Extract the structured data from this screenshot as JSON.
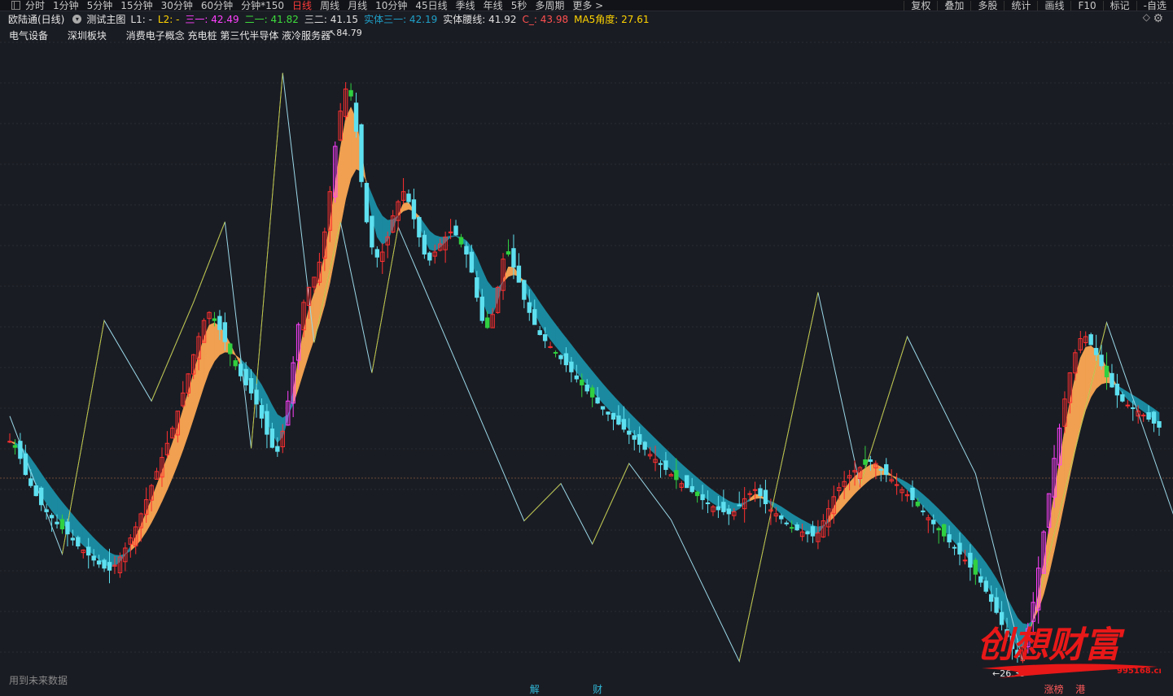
{
  "toolbar": {
    "periods": [
      "分时",
      "1分钟",
      "5分钟",
      "15分钟",
      "30分钟",
      "60分钟",
      "分钟*150",
      "日线",
      "周线",
      "月线",
      "10分钟",
      "45日线",
      "季线",
      "年线",
      "5秒",
      "多周期",
      "更多 >"
    ],
    "active_period": "日线",
    "tools": [
      "复权",
      "叠加",
      "多股",
      "统计",
      "画线",
      "F10",
      "标记",
      "-自选"
    ]
  },
  "info": {
    "stock_name": "欧陆通(日线)",
    "indicator_name": "测试主图",
    "items": [
      {
        "label": "L1: -",
        "color": "#e0e0e0"
      },
      {
        "label": "L2: -",
        "color": "#ffd400"
      },
      {
        "label": "三一: 42.49",
        "color": "#ff40ff"
      },
      {
        "label": "二一: 41.82",
        "color": "#3cdc3c"
      },
      {
        "label": "三二: 41.15",
        "color": "#e0e0e0"
      },
      {
        "label": "实体三一: 42.19",
        "color": "#1fa0c8"
      },
      {
        "label": "实体腰线: 41.92",
        "color": "#e0e0e0"
      },
      {
        "label": "C_: 43.98",
        "color": "#ff5050"
      },
      {
        "label": "MA5角度: 27.61",
        "color": "#ffd400"
      }
    ]
  },
  "sectors": [
    "电气设备",
    "深圳板块",
    "消费电子概念 充电桩 第三代半导体 液冷服务器"
  ],
  "chart_data": {
    "type": "candlestick",
    "title": "欧陆通(日线)",
    "high_label": "84.79",
    "low_label": "26.35",
    "closes": [
      48.2,
      47.6,
      46.5,
      44.9,
      43.8,
      42.8,
      41.9,
      41.2,
      40.6,
      40.0,
      39.5,
      39.0,
      38.4,
      37.8,
      37.4,
      36.9,
      36.4,
      36.0,
      35.6,
      35.4,
      35.9,
      36.7,
      37.6,
      38.6,
      39.7,
      41.0,
      42.4,
      43.8,
      45.2,
      46.6,
      48.0,
      49.5,
      51.2,
      53.0,
      54.9,
      56.8,
      58.6,
      60.2,
      61.0,
      60.2,
      59.3,
      58.1,
      56.9,
      55.7,
      54.7,
      53.8,
      53.0,
      51.9,
      50.5,
      48.9,
      47.6,
      47.2,
      49.2,
      52.2,
      56.0,
      59.8,
      62.0,
      63.5,
      64.5,
      66.0,
      69.0,
      73.0,
      77.5,
      81.0,
      83.2,
      82.5,
      79.0,
      74.0,
      70.0,
      67.5,
      66.5,
      67.0,
      68.5,
      70.6,
      72.0,
      73.0,
      72.0,
      70.3,
      68.5,
      66.8,
      66.2,
      67.0,
      67.8,
      68.5,
      69.0,
      68.7,
      67.8,
      66.8,
      65.0,
      62.5,
      60.2,
      59.5,
      60.8,
      63.5,
      66.3,
      66.8,
      65.5,
      64.0,
      62.3,
      61.0,
      59.8,
      58.8,
      58.2,
      57.6,
      57.0,
      56.4,
      55.8,
      55.1,
      54.4,
      53.8,
      53.2,
      52.6,
      52.0,
      51.4,
      50.9,
      50.4,
      49.9,
      49.4,
      48.9,
      48.4,
      47.9,
      47.4,
      46.9,
      46.4,
      45.9,
      45.4,
      44.9,
      44.4,
      44.0,
      43.6,
      43.2,
      42.8,
      42.4,
      42.0,
      41.7,
      41.4,
      41.2,
      41.0,
      41.2,
      41.8,
      42.5,
      43.0,
      43.4,
      42.8,
      42.0,
      41.4,
      41.0,
      40.5,
      40.0,
      39.6,
      39.4,
      39.2,
      39.0,
      38.8,
      39.1,
      40.3,
      41.5,
      42.7,
      43.6,
      44.2,
      44.8,
      45.3,
      45.6,
      45.9,
      46.2,
      46.0,
      45.4,
      44.9,
      44.4,
      43.9,
      43.4,
      42.9,
      42.4,
      41.8,
      41.2,
      40.6,
      40.0,
      39.4,
      38.8,
      38.2,
      37.6,
      37.0,
      36.4,
      35.7,
      35.0,
      34.2,
      33.3,
      32.3,
      31.2,
      30.0,
      28.8,
      27.6,
      26.8,
      27.8,
      29.6,
      32.2,
      35.6,
      39.2,
      43.0,
      46.5,
      49.5,
      52.4,
      55.0,
      57.0,
      58.4,
      58.6,
      57.8,
      56.8,
      55.7,
      54.6,
      53.6,
      52.8,
      52.2,
      51.8,
      51.5,
      51.2,
      50.8,
      50.4,
      50.0,
      49.6
    ],
    "zigzag": [
      [
        0,
        50.7
      ],
      [
        10,
        37.0
      ],
      [
        18,
        60.2
      ],
      [
        27,
        52.2
      ],
      [
        35,
        62.0
      ],
      [
        41,
        70.0
      ],
      [
        46,
        47.5
      ],
      [
        52,
        84.79
      ],
      [
        58,
        58.0
      ],
      [
        63,
        70.0
      ],
      [
        69,
        55.0
      ],
      [
        74,
        69.5
      ],
      [
        98,
        40.3
      ],
      [
        105,
        44.0
      ],
      [
        111,
        38.0
      ],
      [
        118,
        46.0
      ],
      [
        126,
        40.4
      ],
      [
        139,
        26.35
      ],
      [
        154,
        63.0
      ],
      [
        162,
        43.8
      ],
      [
        171,
        58.6
      ],
      [
        184,
        45.0
      ],
      [
        193,
        26.35
      ],
      [
        209,
        60.0
      ],
      [
        223,
        39.0
      ],
      [
        228,
        43.98
      ]
    ],
    "bottom_markers": [
      {
        "i": 100,
        "text": "解",
        "color": "#30b8d8"
      },
      {
        "i": 112,
        "text": "财",
        "color": "#30b8d8"
      },
      {
        "i": 198,
        "text": "涨榜",
        "color": "#ff5a5a"
      },
      {
        "i": 204,
        "text": "港",
        "color": "#ff5a5a"
      }
    ],
    "ylim": [
      25,
      88
    ],
    "grid": "horizontal dashed",
    "band_colors": {
      "up": "#f0a050",
      "down": "#1b8aa0"
    },
    "candle_colors": {
      "up": "#ff3030",
      "down": "#5ee0f0",
      "limit_up": "#ff40ff",
      "green": "#30d040"
    }
  },
  "footnote": "用到未来数据",
  "watermark": {
    "brand": "创想财富",
    "site": "995168.cn"
  }
}
